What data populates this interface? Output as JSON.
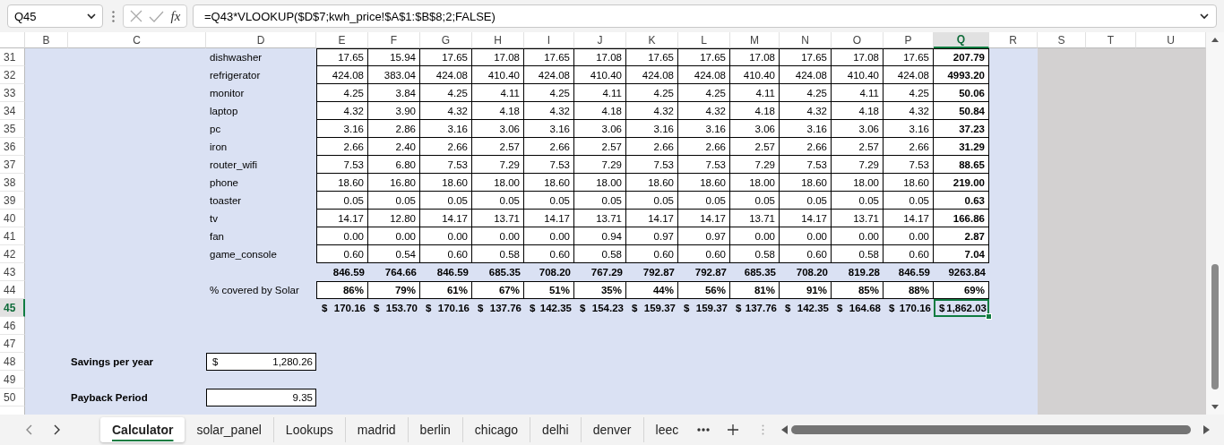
{
  "formula_bar": {
    "name_box": "Q45",
    "fx": "fx",
    "formula": "=Q43*VLOOKUP($D$7;kwh_price!$A$1:$B$8;2;FALSE)"
  },
  "sheet": {
    "columns": [
      {
        "letter": "B",
        "selected": false
      },
      {
        "letter": "C",
        "selected": false
      },
      {
        "letter": "D",
        "selected": false
      },
      {
        "letter": "E",
        "selected": false
      },
      {
        "letter": "F",
        "selected": false
      },
      {
        "letter": "G",
        "selected": false
      },
      {
        "letter": "H",
        "selected": false
      },
      {
        "letter": "I",
        "selected": false
      },
      {
        "letter": "J",
        "selected": false
      },
      {
        "letter": "K",
        "selected": false
      },
      {
        "letter": "L",
        "selected": false
      },
      {
        "letter": "M",
        "selected": false
      },
      {
        "letter": "N",
        "selected": false
      },
      {
        "letter": "O",
        "selected": false
      },
      {
        "letter": "P",
        "selected": false
      },
      {
        "letter": "Q",
        "selected": true
      },
      {
        "letter": "R",
        "selected": false
      },
      {
        "letter": "S",
        "selected": false
      },
      {
        "letter": "T",
        "selected": false
      },
      {
        "letter": "U",
        "selected": false
      }
    ],
    "rows": [
      {
        "number": "31",
        "selected": false,
        "kind": "item",
        "label": "dishwasher",
        "values": [
          "17.65",
          "15.94",
          "17.65",
          "17.08",
          "17.65",
          "17.08",
          "17.65",
          "17.65",
          "17.08",
          "17.65",
          "17.08",
          "17.65",
          "207.79"
        ]
      },
      {
        "number": "32",
        "selected": false,
        "kind": "item",
        "label": "refrigerator",
        "values": [
          "424.08",
          "383.04",
          "424.08",
          "410.40",
          "424.08",
          "410.40",
          "424.08",
          "424.08",
          "410.40",
          "424.08",
          "410.40",
          "424.08",
          "4993.20"
        ]
      },
      {
        "number": "33",
        "selected": false,
        "kind": "item",
        "label": "monitor",
        "values": [
          "4.25",
          "3.84",
          "4.25",
          "4.11",
          "4.25",
          "4.11",
          "4.25",
          "4.25",
          "4.11",
          "4.25",
          "4.11",
          "4.25",
          "50.06"
        ]
      },
      {
        "number": "34",
        "selected": false,
        "kind": "item",
        "label": "laptop",
        "values": [
          "4.32",
          "3.90",
          "4.32",
          "4.18",
          "4.32",
          "4.18",
          "4.32",
          "4.32",
          "4.18",
          "4.32",
          "4.18",
          "4.32",
          "50.84"
        ]
      },
      {
        "number": "35",
        "selected": false,
        "kind": "item",
        "label": "pc",
        "values": [
          "3.16",
          "2.86",
          "3.16",
          "3.06",
          "3.16",
          "3.06",
          "3.16",
          "3.16",
          "3.06",
          "3.16",
          "3.06",
          "3.16",
          "37.23"
        ]
      },
      {
        "number": "36",
        "selected": false,
        "kind": "item",
        "label": "iron",
        "values": [
          "2.66",
          "2.40",
          "2.66",
          "2.57",
          "2.66",
          "2.57",
          "2.66",
          "2.66",
          "2.57",
          "2.66",
          "2.57",
          "2.66",
          "31.29"
        ]
      },
      {
        "number": "37",
        "selected": false,
        "kind": "item",
        "label": "router_wifi",
        "values": [
          "7.53",
          "6.80",
          "7.53",
          "7.29",
          "7.53",
          "7.29",
          "7.53",
          "7.53",
          "7.29",
          "7.53",
          "7.29",
          "7.53",
          "88.65"
        ]
      },
      {
        "number": "38",
        "selected": false,
        "kind": "item",
        "label": "phone",
        "values": [
          "18.60",
          "16.80",
          "18.60",
          "18.00",
          "18.60",
          "18.00",
          "18.60",
          "18.60",
          "18.00",
          "18.60",
          "18.00",
          "18.60",
          "219.00"
        ]
      },
      {
        "number": "39",
        "selected": false,
        "kind": "item",
        "label": "toaster",
        "values": [
          "0.05",
          "0.05",
          "0.05",
          "0.05",
          "0.05",
          "0.05",
          "0.05",
          "0.05",
          "0.05",
          "0.05",
          "0.05",
          "0.05",
          "0.63"
        ]
      },
      {
        "number": "40",
        "selected": false,
        "kind": "item",
        "label": "tv",
        "values": [
          "14.17",
          "12.80",
          "14.17",
          "13.71",
          "14.17",
          "13.71",
          "14.17",
          "14.17",
          "13.71",
          "14.17",
          "13.71",
          "14.17",
          "166.86"
        ]
      },
      {
        "number": "41",
        "selected": false,
        "kind": "item",
        "label": "fan",
        "values": [
          "0.00",
          "0.00",
          "0.00",
          "0.00",
          "0.00",
          "0.94",
          "0.97",
          "0.97",
          "0.00",
          "0.00",
          "0.00",
          "0.00",
          "2.87"
        ]
      },
      {
        "number": "42",
        "selected": false,
        "kind": "item",
        "label": "game_console",
        "values": [
          "0.60",
          "0.54",
          "0.60",
          "0.58",
          "0.60",
          "0.58",
          "0.60",
          "0.60",
          "0.58",
          "0.60",
          "0.58",
          "0.60",
          "7.04"
        ]
      },
      {
        "number": "43",
        "selected": false,
        "kind": "total",
        "values": [
          "846.59",
          "764.66",
          "846.59",
          "685.35",
          "708.20",
          "767.29",
          "792.87",
          "792.87",
          "685.35",
          "708.20",
          "819.28",
          "846.59",
          "9263.84"
        ]
      },
      {
        "number": "44",
        "selected": false,
        "kind": "percent",
        "label": "% covered by Solar",
        "values": [
          "86%",
          "79%",
          "61%",
          "67%",
          "51%",
          "35%",
          "44%",
          "56%",
          "81%",
          "91%",
          "85%",
          "88%",
          "69%"
        ]
      },
      {
        "number": "45",
        "selected": true,
        "kind": "cost",
        "values": [
          {
            "currency": "$",
            "amount": "170.16"
          },
          {
            "currency": "$",
            "amount": "153.70"
          },
          {
            "currency": "$",
            "amount": "170.16"
          },
          {
            "currency": "$",
            "amount": "137.76"
          },
          {
            "currency": "$",
            "amount": "142.35"
          },
          {
            "currency": "$",
            "amount": "154.23"
          },
          {
            "currency": "$",
            "amount": "159.37"
          },
          {
            "currency": "$",
            "amount": "159.37"
          },
          {
            "currency": "$",
            "amount": "137.76"
          },
          {
            "currency": "$",
            "amount": "142.35"
          },
          {
            "currency": "$",
            "amount": "164.68"
          },
          {
            "currency": "$",
            "amount": "170.16"
          },
          {
            "currency": "$",
            "amount": "1,862.03"
          }
        ]
      },
      {
        "number": "46",
        "selected": false,
        "kind": "empty"
      },
      {
        "number": "47",
        "selected": false,
        "kind": "empty"
      },
      {
        "number": "48",
        "selected": false,
        "kind": "field",
        "label": "Savings per year",
        "currency": "$",
        "value": "1,280.26"
      },
      {
        "number": "49",
        "selected": false,
        "kind": "empty"
      },
      {
        "number": "50",
        "selected": false,
        "kind": "field",
        "label": "Payback Period",
        "value": "9.35"
      }
    ]
  },
  "sheet_tabs": [
    {
      "label": "Calculator",
      "selected": true
    },
    {
      "label": "solar_panel",
      "selected": false
    },
    {
      "label": "Lookups",
      "selected": false
    },
    {
      "label": "madrid",
      "selected": false
    },
    {
      "label": "berlin",
      "selected": false
    },
    {
      "label": "chicago",
      "selected": false
    },
    {
      "label": "delhi",
      "selected": false
    },
    {
      "label": "denver",
      "selected": false
    },
    {
      "label": "leec",
      "selected": false
    }
  ]
}
